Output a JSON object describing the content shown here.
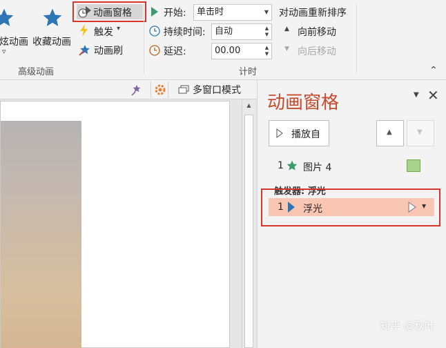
{
  "ribbon": {
    "advanced_group": {
      "label": "高级动画",
      "add_animation_partial": "炫动画",
      "add_animation_arrow": "▿",
      "favorite_animation": "收藏动画",
      "animation_pane": "动画窗格",
      "trigger": "触发",
      "trigger_arrow": "▾",
      "animation_painter": "动画刷"
    },
    "timing_group": {
      "label": "计时",
      "start_label": "开始:",
      "start_value": "单击时",
      "duration_label": "持续时间:",
      "duration_value": "自动",
      "delay_label": "延迟:",
      "delay_value": "00.00",
      "reorder_title": "对动画重新排序",
      "move_earlier": "向前移动",
      "move_later": "向后移动"
    },
    "collapse_glyph": "⌃"
  },
  "editor": {
    "multi_window": "多窗口模式"
  },
  "pane": {
    "title": "动画窗格",
    "play_from": "播放自",
    "items": [
      {
        "number": "1",
        "name": "图片 4"
      }
    ],
    "trigger_header": "触发器: 浮光",
    "trigger_items": [
      {
        "number": "1",
        "name": "浮光"
      }
    ]
  },
  "watermark": "知乎 @秋叶",
  "colors": {
    "accent_red": "#d9342b",
    "pane_title": "#c8492c",
    "star_blue": "#2e75b6",
    "item_green": "#3d9a6a",
    "trigger_highlight": "#f9c6b4"
  }
}
